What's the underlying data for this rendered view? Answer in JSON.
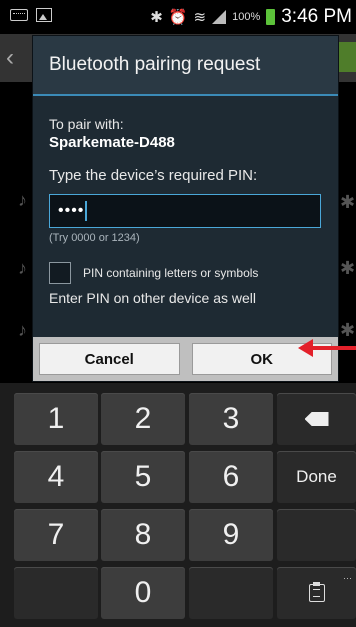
{
  "status_bar": {
    "battery_percent": "100%",
    "time": "3:46 PM"
  },
  "dialog": {
    "title": "Bluetooth pairing request",
    "to_pair_label": "To pair with:",
    "device_name": "Sparkemate-D488",
    "pin_prompt": "Type the device’s required PIN:",
    "pin_value": "••••",
    "pin_hint": "(Try 0000 or 1234)",
    "checkbox_label": "PIN containing letters or symbols",
    "enter_pin_note": "Enter PIN on other device as well",
    "cancel_label": "Cancel",
    "ok_label": "OK"
  },
  "keyboard": {
    "keys": [
      "1",
      "2",
      "3",
      "4",
      "5",
      "6",
      "7",
      "8",
      "9",
      "0"
    ],
    "done_label": "Done"
  },
  "colors": {
    "annotation_arrow": "#e3202a",
    "field_focus": "#4aa7d8",
    "battery": "#5cc23a"
  }
}
